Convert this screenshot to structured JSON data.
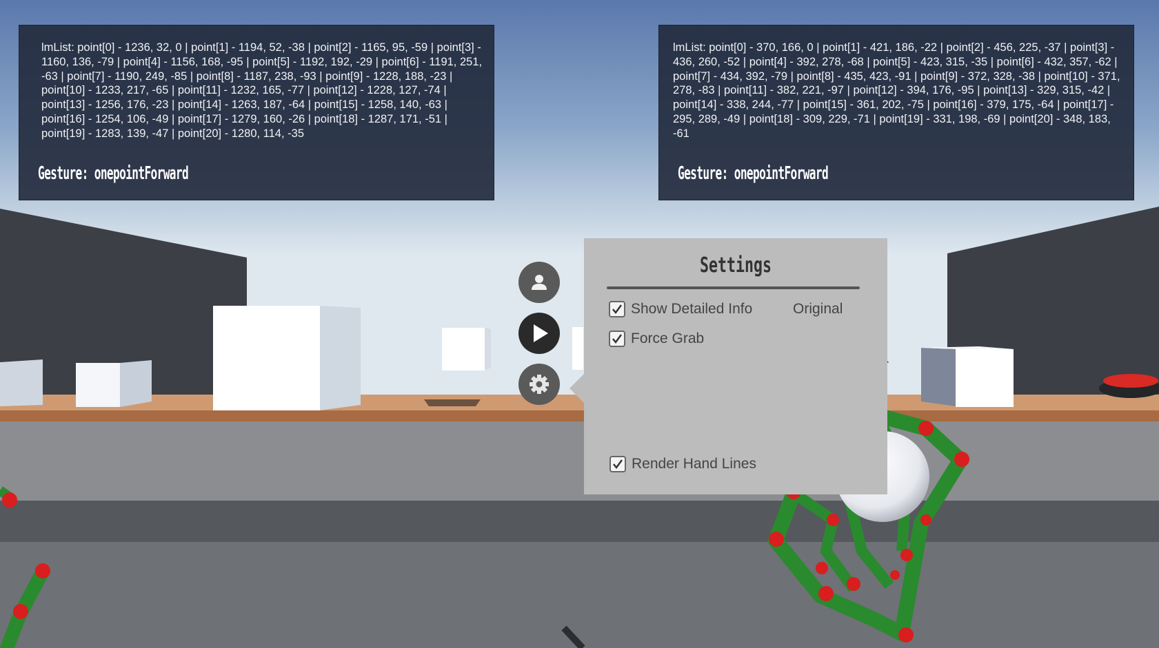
{
  "left_panel": {
    "lmlist_text": "lmList: point[0] - 1236, 32, 0 | point[1] - 1194, 52, -38 | point[2] - 1165, 95, -59 | point[3] - 1160, 136, -79 | point[4] - 1156, 168, -95 | point[5] - 1192, 192, -29 | point[6] - 1191, 251, -63 | point[7] - 1190, 249, -85 | point[8] - 1187, 238, -93 | point[9] - 1228, 188, -23 | point[10] - 1233, 217, -65 | point[11] - 1232, 165, -77 | point[12] - 1228, 127, -74 | point[13] - 1256, 176, -23 | point[14] - 1263, 187, -64 | point[15] - 1258, 140, -63 | point[16] - 1254, 106, -49 | point[17] - 1279, 160, -26 | point[18] - 1287, 171, -51 | point[19] - 1283, 139, -47 | point[20] - 1280, 114, -35",
    "gesture": "Gesture: onepointForward"
  },
  "right_panel": {
    "lmlist_text": "lmList: point[0] - 370, 166, 0 | point[1] - 421, 186, -22 | point[2] - 456, 225, -37 | point[3] - 436, 260, -52 | point[4] - 392, 278, -68 | point[5] - 423, 315, -35 | point[6] - 432, 357, -62 | point[7] - 434, 392, -79 | point[8] - 435, 423, -91 | point[9] - 372, 328, -38 | point[10] - 371, 278, -83 | point[11] - 382, 221, -97 | point[12] - 394, 176, -95 | point[13] - 329, 315, -42 | point[14] - 338, 244, -77 | point[15] - 361, 202, -75 | point[16] - 379, 175, -64 | point[17] - 295, 289, -49 | point[18] - 309, 229, -71 | point[19] - 331, 198, -69 | point[20] - 348, 183, -61",
    "gesture": "Gesture: onepointForward"
  },
  "menu": {
    "buttons": [
      "user-icon",
      "play-icon",
      "gear-icon"
    ]
  },
  "settings": {
    "title": "Settings",
    "options": {
      "show_detailed_info": {
        "label": "Show Detailed Info",
        "checked": true
      },
      "original": {
        "label": "Original"
      },
      "force_grab": {
        "label": "Force Grab",
        "checked": true
      },
      "render_hand_lines": {
        "label": "Render Hand Lines",
        "checked": true
      }
    }
  },
  "colors": {
    "panel_bg": "#222a3c",
    "settings_bg": "#bcbcbc",
    "hand_green": "#2a8a2e",
    "joint_red": "#d81e1e",
    "floor_wood": "#cf9a72",
    "sky_top": "#5a78ac",
    "sky_horizon": "#dfe8ef"
  }
}
